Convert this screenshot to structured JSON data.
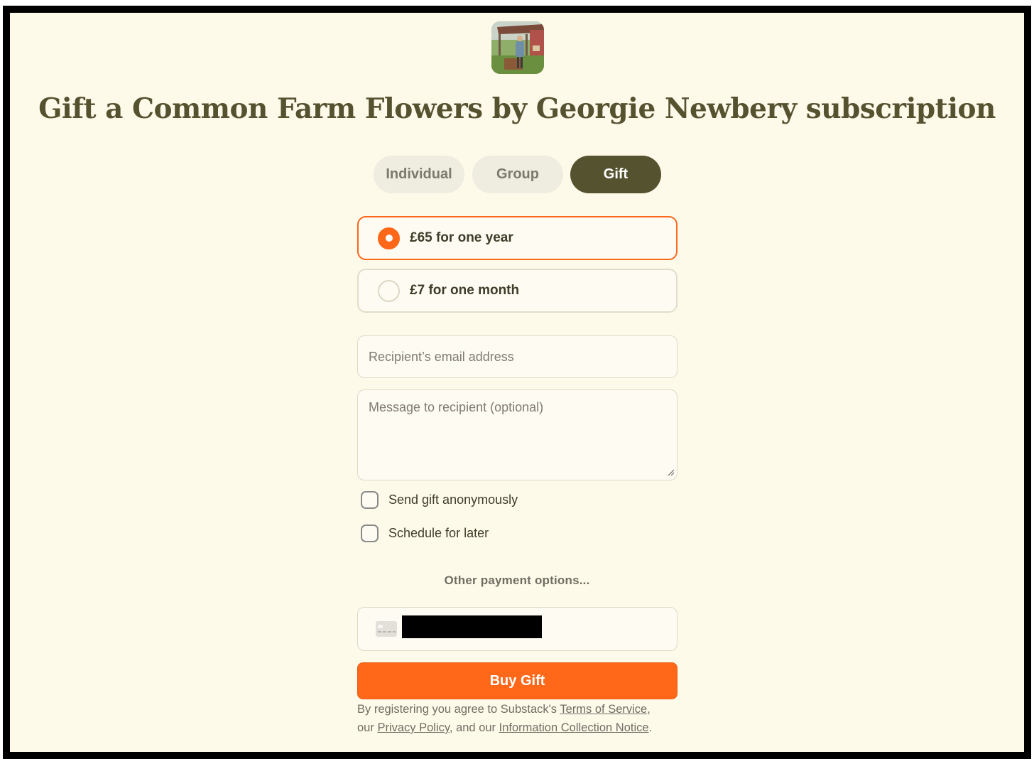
{
  "title": "Gift a Common Farm Flowers by Georgie Newbery subscription",
  "tabs": [
    {
      "label": "Individual",
      "active": false
    },
    {
      "label": "Group",
      "active": false
    },
    {
      "label": "Gift",
      "active": true
    }
  ],
  "plans": [
    {
      "label": "£65 for one year",
      "selected": true
    },
    {
      "label": "£7 for one month",
      "selected": false
    }
  ],
  "form": {
    "email_placeholder": "Recipient’s email address",
    "email_value": "",
    "message_placeholder": "Message to recipient (optional)",
    "message_value": ""
  },
  "options": {
    "anonymous_label": "Send gift anonymously",
    "anonymous_checked": false,
    "schedule_label": "Schedule for later",
    "schedule_checked": false
  },
  "other_payment_label": "Other payment options...",
  "buy_label": "Buy Gift",
  "legal": {
    "prefix": "By registering you agree to Substack's ",
    "terms": "Terms of Service",
    "sep1": ",",
    "line2_prefix": "our ",
    "privacy": "Privacy Policy",
    "sep2": ", and our ",
    "notice": "Information Collection Notice",
    "end": "."
  },
  "colors": {
    "accent": "#ff6719",
    "brand_dark": "#555230",
    "background": "#fdfaea"
  }
}
